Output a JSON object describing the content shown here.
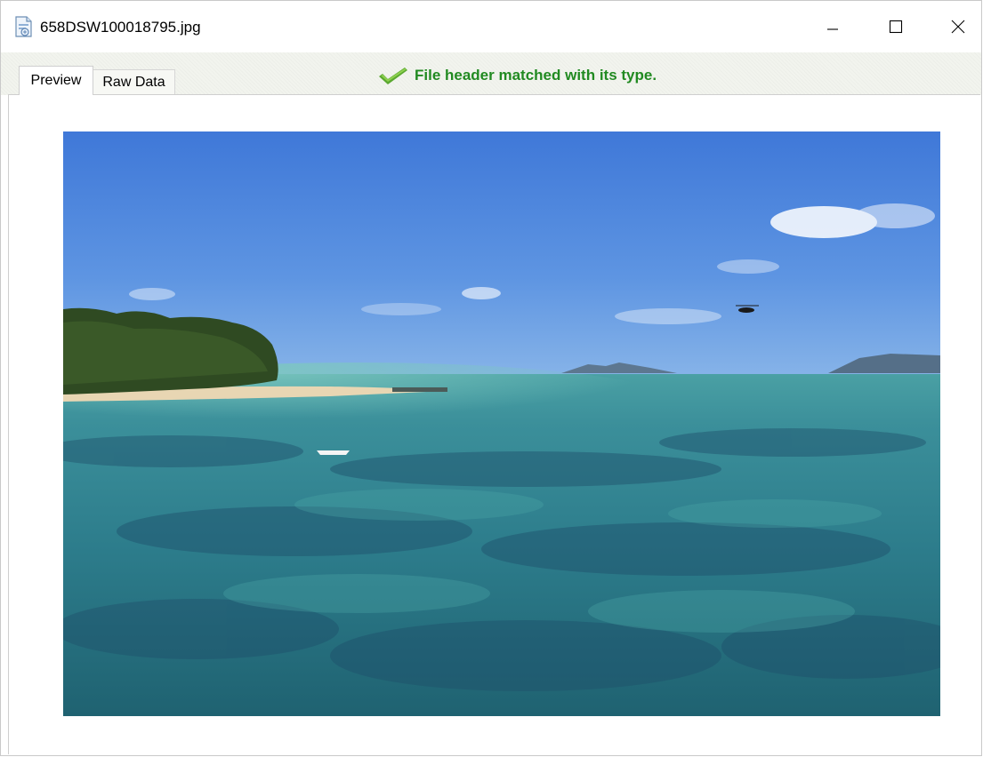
{
  "window": {
    "title": "658DSW100018795.jpg",
    "icons": {
      "app": "image-file-icon",
      "minimize": "minimize-icon",
      "maximize": "maximize-icon",
      "close": "close-icon"
    }
  },
  "tabs": [
    {
      "label": "Preview",
      "active": true
    },
    {
      "label": "Raw Data",
      "active": false
    }
  ],
  "status": {
    "icon": "checkmark-icon",
    "text": "File header matched with its type.",
    "color": "#218a21"
  },
  "preview": {
    "subject": "photo of a tropical beach with turquoise reef water, island with trees on the left, distant mountains and a helicopter in a blue sky"
  }
}
